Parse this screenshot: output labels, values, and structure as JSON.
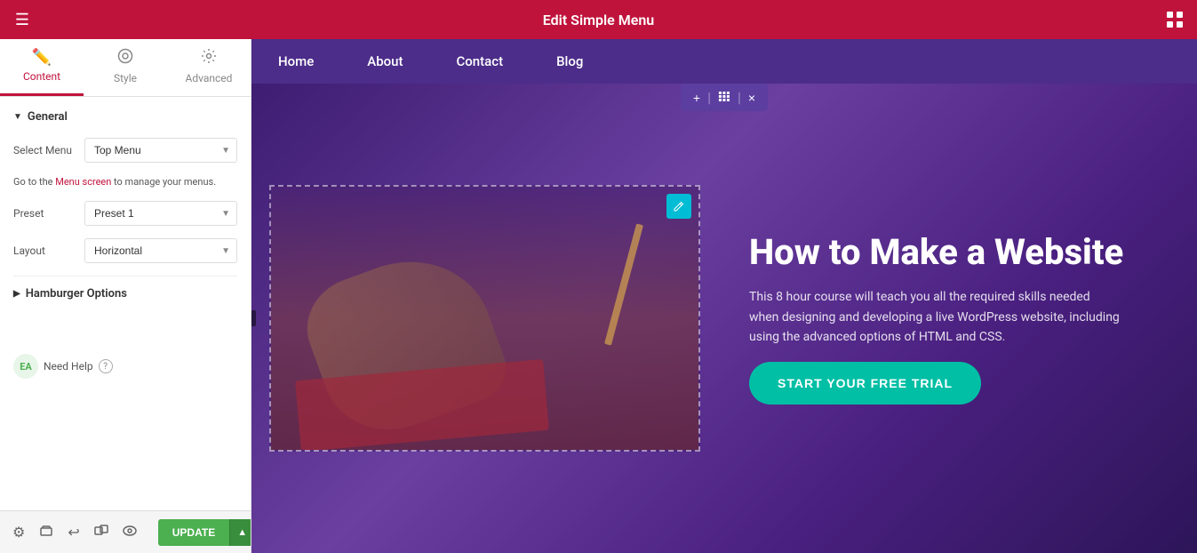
{
  "topbar": {
    "title": "Edit Simple Menu",
    "hamburger_icon": "☰",
    "grid_icon": "⊞"
  },
  "tabs": [
    {
      "id": "content",
      "label": "Content",
      "icon": "✏️",
      "active": true
    },
    {
      "id": "style",
      "label": "Style",
      "icon": "🎨",
      "active": false
    },
    {
      "id": "advanced",
      "label": "Advanced",
      "icon": "⚙️",
      "active": false
    }
  ],
  "panel": {
    "general_section": "General",
    "select_menu_label": "Select Menu",
    "select_menu_value": "Top Menu",
    "menu_link_text_before": "Go to the ",
    "menu_link_anchor": "Menu screen",
    "menu_link_text_after": " to manage your menus.",
    "preset_label": "Preset",
    "preset_value": "Preset 1",
    "layout_label": "Layout",
    "layout_value": "Horizontal",
    "hamburger_section": "Hamburger Options",
    "need_help_label": "Need Help",
    "update_btn": "UPDATE"
  },
  "nav": {
    "items": [
      {
        "label": "Home"
      },
      {
        "label": "About"
      },
      {
        "label": "Contact"
      },
      {
        "label": "Blog"
      }
    ]
  },
  "floating_toolbar": {
    "plus": "+",
    "drag": "⠿",
    "close": "×"
  },
  "hero": {
    "title": "How to Make a Website",
    "description": "This 8 hour course will teach you all the required skills needed when designing and developing a live WordPress website, including using the advanced options of HTML and CSS.",
    "cta_label": "START YOUR FREE TRIAL"
  },
  "bottombar": {
    "icons": [
      "⚙",
      "◫",
      "↩",
      "⬚",
      "👁"
    ],
    "update": "UPDATE"
  }
}
